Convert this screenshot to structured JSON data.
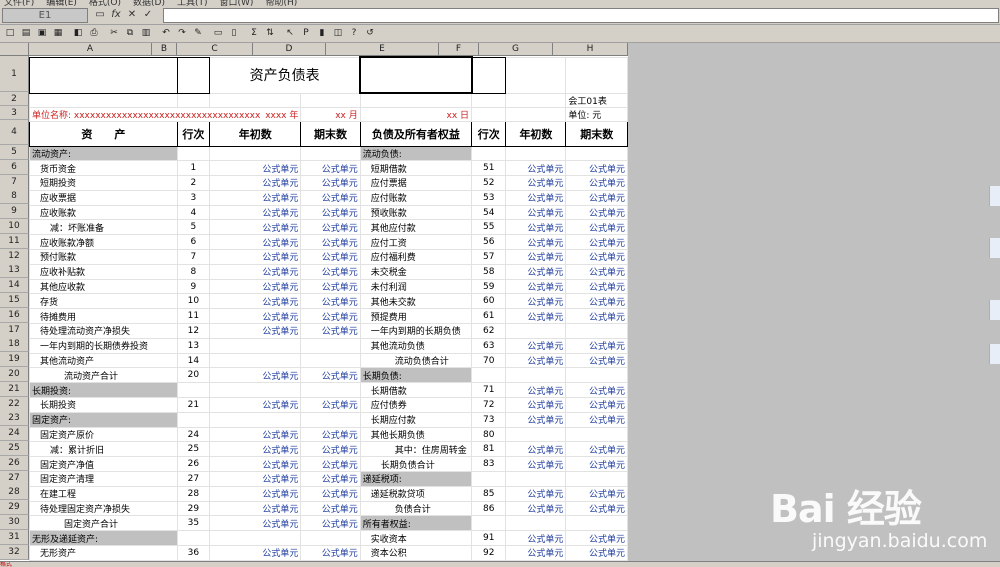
{
  "menu": [
    "文件(F)",
    "编辑(E)",
    "格式(O)",
    "数据(D)",
    "工具(T)",
    "窗口(W)",
    "帮助(H)"
  ],
  "formula_bar": {
    "cell_ref": "E1",
    "value": ""
  },
  "toolbar_icons": [
    "new-icon",
    "open-icon",
    "save-icon",
    "save-all-icon",
    "print-preview-icon",
    "print-icon",
    "cut-icon",
    "copy-icon",
    "paste-icon",
    "undo-icon",
    "redo-icon",
    "format-painter-icon",
    "insert-row-icon",
    "insert-col-icon",
    "sum-icon",
    "sort-icon",
    "pointer-icon",
    "param-icon",
    "doc-icon",
    "calc-icon",
    "help-icon",
    "back-icon"
  ],
  "columns": [
    "A",
    "B",
    "C",
    "D",
    "E",
    "F",
    "G",
    "H"
  ],
  "sheet": {
    "title": "资产负债表",
    "form_no": "会工01表",
    "unit_name_label": "单位名称: xxxxxxxxxxxxxxxxxxxxxxxxxxxxxxxxxxx",
    "year_label": "xxxx 年",
    "month_label": "xx 月",
    "day_label": "xx 日",
    "unit_label": "单位: 元",
    "header": {
      "asset": "资　　产",
      "row_no": "行次",
      "begin": "年初数",
      "end": "期末数",
      "liab": "负债及所有者权益",
      "row_no2": "行次",
      "begin2": "年初数",
      "end2": "期末数"
    },
    "rows": [
      {
        "a": "流动资产:",
        "b": "",
        "c": "",
        "d": "",
        "e": "流动负债:",
        "f": "",
        "g": "",
        "h": ""
      },
      {
        "a": "货币资金",
        "b": "1",
        "c": "公式单元",
        "d": "公式单元",
        "e": "短期借款",
        "f": "51",
        "g": "公式单元",
        "h": "公式单元"
      },
      {
        "a": "短期投资",
        "b": "2",
        "c": "公式单元",
        "d": "公式单元",
        "e": "应付票据",
        "f": "52",
        "g": "公式单元",
        "h": "公式单元"
      },
      {
        "a": "应收票据",
        "b": "3",
        "c": "公式单元",
        "d": "公式单元",
        "e": "应付账款",
        "f": "53",
        "g": "公式单元",
        "h": "公式单元"
      },
      {
        "a": "应收账款",
        "b": "4",
        "c": "公式单元",
        "d": "公式单元",
        "e": "预收账款",
        "f": "54",
        "g": "公式单元",
        "h": "公式单元"
      },
      {
        "a": "减：坏账准备",
        "b": "5",
        "c": "公式单元",
        "d": "公式单元",
        "e": "其他应付款",
        "f": "55",
        "g": "公式单元",
        "h": "公式单元"
      },
      {
        "a": "应收账款净额",
        "b": "6",
        "c": "公式单元",
        "d": "公式单元",
        "e": "应付工资",
        "f": "56",
        "g": "公式单元",
        "h": "公式单元"
      },
      {
        "a": "预付账款",
        "b": "7",
        "c": "公式单元",
        "d": "公式单元",
        "e": "应付福利费",
        "f": "57",
        "g": "公式单元",
        "h": "公式单元"
      },
      {
        "a": "应收补贴款",
        "b": "8",
        "c": "公式单元",
        "d": "公式单元",
        "e": "未交税金",
        "f": "58",
        "g": "公式单元",
        "h": "公式单元"
      },
      {
        "a": "其他应收款",
        "b": "9",
        "c": "公式单元",
        "d": "公式单元",
        "e": "未付利润",
        "f": "59",
        "g": "公式单元",
        "h": "公式单元"
      },
      {
        "a": "存货",
        "b": "10",
        "c": "公式单元",
        "d": "公式单元",
        "e": "其他未交款",
        "f": "60",
        "g": "公式单元",
        "h": "公式单元"
      },
      {
        "a": "待摊费用",
        "b": "11",
        "c": "公式单元",
        "d": "公式单元",
        "e": "预提费用",
        "f": "61",
        "g": "公式单元",
        "h": "公式单元"
      },
      {
        "a": "待处理流动资产净损失",
        "b": "12",
        "c": "公式单元",
        "d": "公式单元",
        "e": "一年内到期的长期负债",
        "f": "62",
        "g": "",
        "h": ""
      },
      {
        "a": "一年内到期的长期债券投资",
        "b": "13",
        "c": "",
        "d": "",
        "e": "其他流动负债",
        "f": "63",
        "g": "公式单元",
        "h": "公式单元"
      },
      {
        "a": "其他流动资产",
        "b": "14",
        "c": "",
        "d": "",
        "e": "流动负债合计",
        "f": "70",
        "g": "公式单元",
        "h": "公式单元"
      },
      {
        "a": "流动资产合计",
        "b": "20",
        "c": "公式单元",
        "d": "公式单元",
        "e": "长期负债:",
        "f": "",
        "g": "",
        "h": ""
      },
      {
        "a": "长期投资:",
        "b": "",
        "c": "",
        "d": "",
        "e": "长期借款",
        "f": "71",
        "g": "公式单元",
        "h": "公式单元"
      },
      {
        "a": "长期投资",
        "b": "21",
        "c": "公式单元",
        "d": "公式单元",
        "e": "应付债券",
        "f": "72",
        "g": "公式单元",
        "h": "公式单元"
      },
      {
        "a": "固定资产:",
        "b": "",
        "c": "",
        "d": "",
        "e": "长期应付款",
        "f": "73",
        "g": "公式单元",
        "h": "公式单元"
      },
      {
        "a": "固定资产原价",
        "b": "24",
        "c": "公式单元",
        "d": "公式单元",
        "e": "其他长期负债",
        "f": "80",
        "g": "",
        "h": ""
      },
      {
        "a": "减：累计折旧",
        "b": "25",
        "c": "公式单元",
        "d": "公式单元",
        "e": "其中：住房周转金",
        "f": "81",
        "g": "公式单元",
        "h": "公式单元"
      },
      {
        "a": "固定资产净值",
        "b": "26",
        "c": "公式单元",
        "d": "公式单元",
        "e": "长期负债合计",
        "f": "83",
        "g": "公式单元",
        "h": "公式单元"
      },
      {
        "a": "固定资产清理",
        "b": "27",
        "c": "公式单元",
        "d": "公式单元",
        "e": "递延税项:",
        "f": "",
        "g": "",
        "h": ""
      },
      {
        "a": "在建工程",
        "b": "28",
        "c": "公式单元",
        "d": "公式单元",
        "e": "递延税款贷项",
        "f": "85",
        "g": "公式单元",
        "h": "公式单元"
      },
      {
        "a": "待处理固定资产净损失",
        "b": "29",
        "c": "公式单元",
        "d": "公式单元",
        "e": "负债合计",
        "f": "86",
        "g": "公式单元",
        "h": "公式单元"
      },
      {
        "a": "固定资产合计",
        "b": "35",
        "c": "公式单元",
        "d": "公式单元",
        "e": "所有者权益:",
        "f": "",
        "g": "",
        "h": ""
      },
      {
        "a": "无形及递延资产:",
        "b": "",
        "c": "",
        "d": "",
        "e": "实收资本",
        "f": "91",
        "g": "公式单元",
        "h": "公式单元"
      },
      {
        "a": "无形资产",
        "b": "36",
        "c": "公式单元",
        "d": "公式单元",
        "e": "资本公积",
        "f": "92",
        "g": "公式单元",
        "h": "公式单元"
      }
    ]
  },
  "status": {
    "mode": "格式"
  },
  "watermark": {
    "brand": "Bai 经验",
    "url": "jingyan.baidu.com"
  }
}
